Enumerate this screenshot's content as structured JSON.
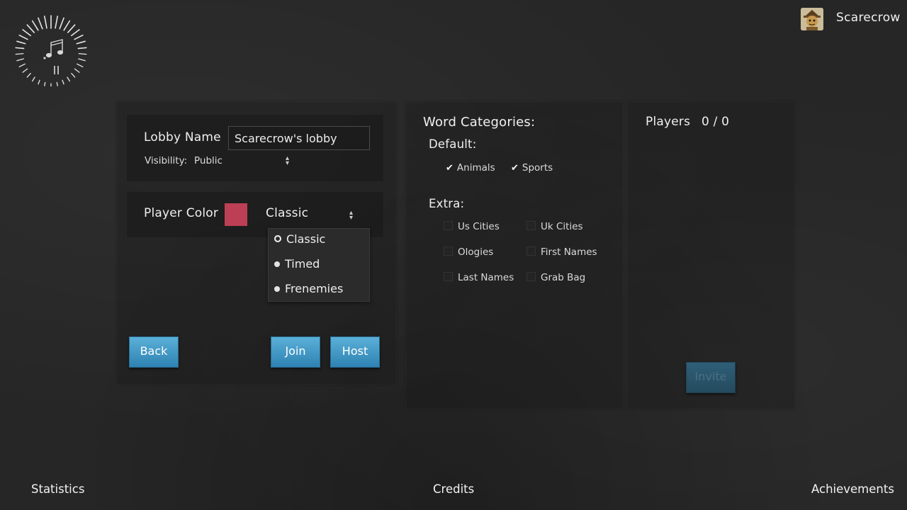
{
  "user": {
    "name": "Scarecrow",
    "avatar_icon": "scarecrow-avatar"
  },
  "music_dial": {
    "icon": "music-note-icon",
    "state_icon": "pause-icon"
  },
  "lobby": {
    "name_label": "Lobby Name",
    "name_value": "Scarecrow's lobby",
    "visibility_label": "Visibility:",
    "visibility_value": "Public"
  },
  "player": {
    "color_label": "Player Color",
    "color": "#bd3f55",
    "mode_selected": "Classic",
    "mode_options": [
      "Classic",
      "Timed",
      "Frenemies"
    ]
  },
  "buttons": {
    "back": "Back",
    "join": "Join",
    "host": "Host",
    "invite": "Invite"
  },
  "categories": {
    "title": "Word Categories:",
    "default_label": "Default:",
    "default_items": [
      {
        "label": "Animals",
        "checked": true
      },
      {
        "label": "Sports",
        "checked": true
      }
    ],
    "extra_label": "Extra:",
    "extra_items": [
      {
        "label": "Us Cities",
        "checked": false
      },
      {
        "label": "Uk Cities",
        "checked": false
      },
      {
        "label": "Ologies",
        "checked": false
      },
      {
        "label": "First Names",
        "checked": false
      },
      {
        "label": "Last Names",
        "checked": false
      },
      {
        "label": "Grab Bag",
        "checked": false
      }
    ]
  },
  "players": {
    "label": "Players",
    "count": "0 / 0"
  },
  "footer": {
    "statistics": "Statistics",
    "credits": "Credits",
    "achievements": "Achievements"
  },
  "colors": {
    "button": "#3f97c6",
    "invite_disabled": "#2a5569",
    "background": "#262626"
  }
}
